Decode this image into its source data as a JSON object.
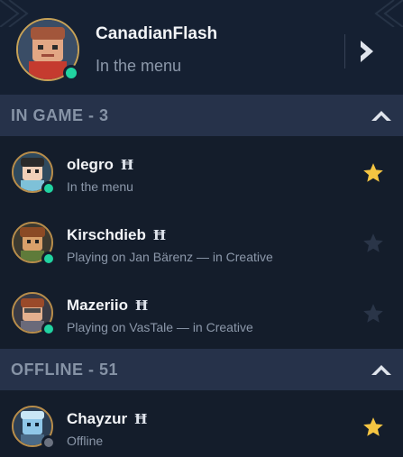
{
  "profile": {
    "name": "CanadianFlash",
    "status": "In the menu",
    "status_color": "#21d3a1"
  },
  "sections": [
    {
      "title": "IN GAME - 3",
      "friends": [
        {
          "name": "olegro",
          "badge": "Ħ",
          "status": "In the menu",
          "online": true,
          "favorite": true
        },
        {
          "name": "Kirschdieb",
          "badge": "Ħ",
          "status": "Playing on Jan Bärenz — in Creative",
          "online": true,
          "favorite": false
        },
        {
          "name": "Mazeriio",
          "badge": "Ħ",
          "status": "Playing on VasTale — in Creative",
          "online": true,
          "favorite": false
        }
      ]
    },
    {
      "title": "OFFLINE - 51",
      "friends": [
        {
          "name": "Chayzur",
          "badge": "Ħ",
          "status": "Offline",
          "online": false,
          "favorite": true
        }
      ]
    }
  ],
  "colors": {
    "online": "#21d3a1",
    "offline": "#6b7280",
    "star_on": "#f5c542",
    "star_off": "#2a3548"
  },
  "icons": {
    "expand": "chevron-right-icon",
    "collapse": "chevron-up-icon",
    "favorite": "star-icon"
  }
}
